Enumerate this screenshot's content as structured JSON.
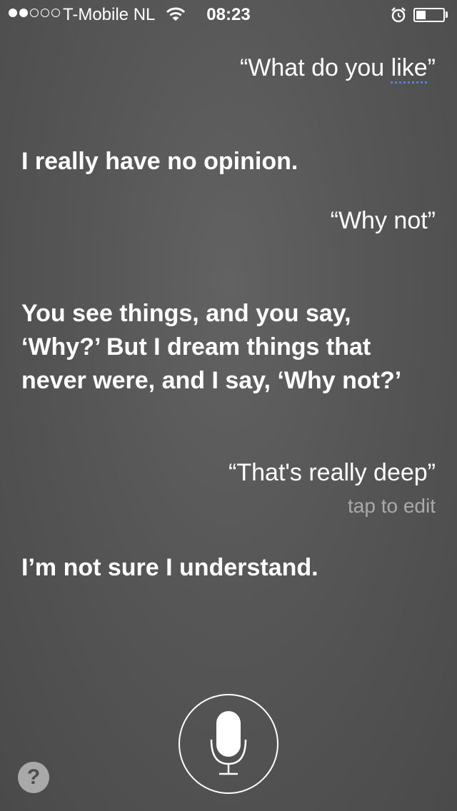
{
  "status_bar": {
    "carrier": "T-Mobile NL",
    "time": "08:23",
    "signal_bars_filled": 2,
    "signal_bars_total": 5,
    "battery_level": 0.35,
    "icons": [
      "wifi-icon",
      "alarm-icon",
      "battery-icon"
    ]
  },
  "conversation": {
    "query_1": {
      "text_before": "“What do you ",
      "text_underlined": "like",
      "text_after": "”"
    },
    "answer_1": "I really have no opinion.",
    "query_2": "“Why not”",
    "answer_2": "You see things, and you say, ‘Why?’ But I dream things that never were, and I say, ‘Why not?’",
    "query_3": "“That's really deep”",
    "query_3_hint": "tap to edit",
    "answer_3": "I’m not sure I understand."
  },
  "controls": {
    "help_label": "?",
    "mic_icon": "microphone-icon"
  },
  "colors": {
    "background": "#575757",
    "underline_accent": "#3b8cf4",
    "hint_text": "#aaaaaa"
  }
}
